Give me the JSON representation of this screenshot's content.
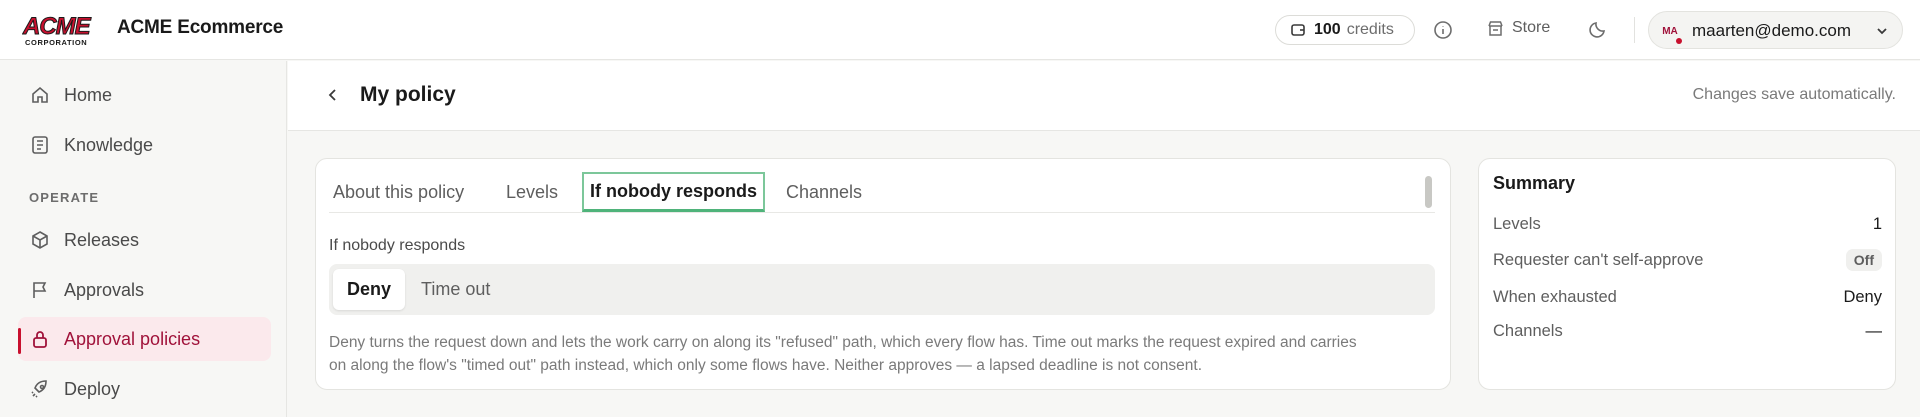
{
  "brand": {
    "logo_main": "ACME",
    "logo_sub": "CORPORATION",
    "app_title": "ACME Ecommerce",
    "accent": "#c8102e"
  },
  "topbar": {
    "credits_value": "100",
    "credits_label": "credits",
    "info_icon": "info-icon",
    "store_label": "Store",
    "theme_icon": "moon-icon",
    "user_initials": "MA",
    "user_email": "maarten@demo.com"
  },
  "sidebar": {
    "items": [
      {
        "label": "Home",
        "icon": "home-icon"
      },
      {
        "label": "Knowledge",
        "icon": "book-icon"
      },
      {
        "label": "Releases",
        "icon": "package-icon"
      },
      {
        "label": "Approvals",
        "icon": "flag-icon"
      },
      {
        "label": "Approval policies",
        "icon": "lock-icon",
        "active": true
      },
      {
        "label": "Deploy",
        "icon": "rocket-icon"
      }
    ],
    "section_operate": "OPERATE"
  },
  "header": {
    "title": "My policy",
    "autosave": "Changes save automatically."
  },
  "tabs": [
    {
      "label": "About this policy"
    },
    {
      "label": "Levels"
    },
    {
      "label": "If nobody responds",
      "active": true
    },
    {
      "label": "Channels"
    }
  ],
  "form": {
    "field_label": "If nobody responds",
    "options": [
      {
        "label": "Deny",
        "selected": true
      },
      {
        "label": "Time out"
      }
    ],
    "help_line1": "Deny turns the request down and lets the work carry on along its \"refused\" path, which every flow has. Time out marks the request expired and carries",
    "help_line2": "on along the flow's \"timed out\" path instead, which only some flows have. Neither approves — a lapsed deadline is not consent."
  },
  "summary": {
    "title": "Summary",
    "rows": [
      {
        "label": "Levels",
        "value": "1"
      },
      {
        "label": "Requester can't self-approve",
        "value": "Off"
      },
      {
        "label": "When exhausted",
        "value": "Deny"
      },
      {
        "label": "Channels",
        "value": "—"
      }
    ]
  }
}
